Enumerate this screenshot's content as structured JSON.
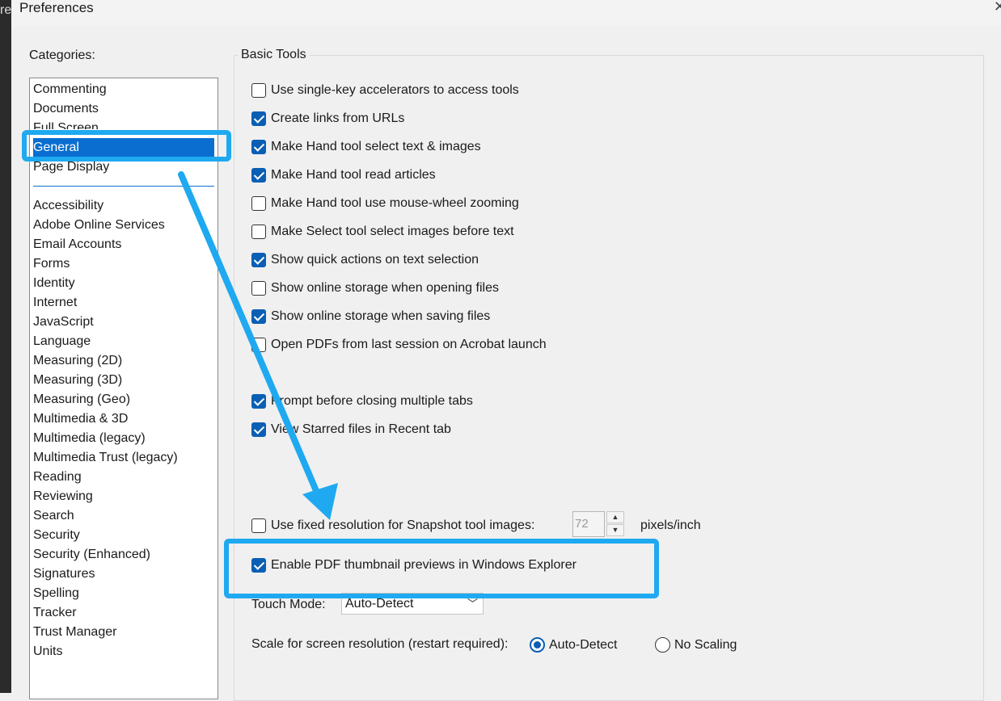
{
  "window": {
    "title": "Preferences",
    "bg_app_text": "re"
  },
  "categories": {
    "label": "Categories:",
    "primary": [
      "Commenting",
      "Documents",
      "Full Screen",
      "General",
      "Page Display"
    ],
    "selected": "General",
    "secondary": [
      "Accessibility",
      "Adobe Online Services",
      "Email Accounts",
      "Forms",
      "Identity",
      "Internet",
      "JavaScript",
      "Language",
      "Measuring (2D)",
      "Measuring (3D)",
      "Measuring (Geo)",
      "Multimedia & 3D",
      "Multimedia (legacy)",
      "Multimedia Trust (legacy)",
      "Reading",
      "Reviewing",
      "Search",
      "Security",
      "Security (Enhanced)",
      "Signatures",
      "Spelling",
      "Tracker",
      "Trust Manager",
      "Units"
    ]
  },
  "basic_tools": {
    "title": "Basic Tools",
    "options": [
      {
        "label": "Use single-key accelerators to access tools",
        "checked": false
      },
      {
        "label": "Create links from URLs",
        "checked": true
      },
      {
        "label": "Make Hand tool select text & images",
        "checked": true
      },
      {
        "label": "Make Hand tool read articles",
        "checked": true
      },
      {
        "label": "Make Hand tool use mouse-wheel zooming",
        "checked": false
      },
      {
        "label": "Make Select tool select images before text",
        "checked": false
      },
      {
        "label": "Show quick actions on text selection",
        "checked": true
      },
      {
        "label": "Show online storage when opening files",
        "checked": false
      },
      {
        "label": "Show online storage when saving files",
        "checked": true
      },
      {
        "label": "Open PDFs from last session on Acrobat launch",
        "checked": false
      },
      {
        "label": "Prompt before closing multiple tabs",
        "checked": true
      },
      {
        "label": "View Starred files in Recent tab",
        "checked": true
      },
      {
        "label": "Use fixed resolution for Snapshot tool images:",
        "checked": false
      },
      {
        "label": "Enable PDF thumbnail previews in Windows Explorer",
        "checked": true
      }
    ],
    "snapshot_resolution": {
      "value": "72",
      "unit": "pixels/inch"
    },
    "touch_mode": {
      "label": "Touch Mode:",
      "value": "Auto-Detect"
    },
    "scale": {
      "label": "Scale for screen resolution (restart required):",
      "options": [
        "Auto-Detect",
        "No Scaling"
      ],
      "selected": "Auto-Detect"
    }
  },
  "colors": {
    "accent": "#0a6ed1",
    "checkbox_blue": "#0a5fb4",
    "highlight": "#1fa9f0"
  }
}
